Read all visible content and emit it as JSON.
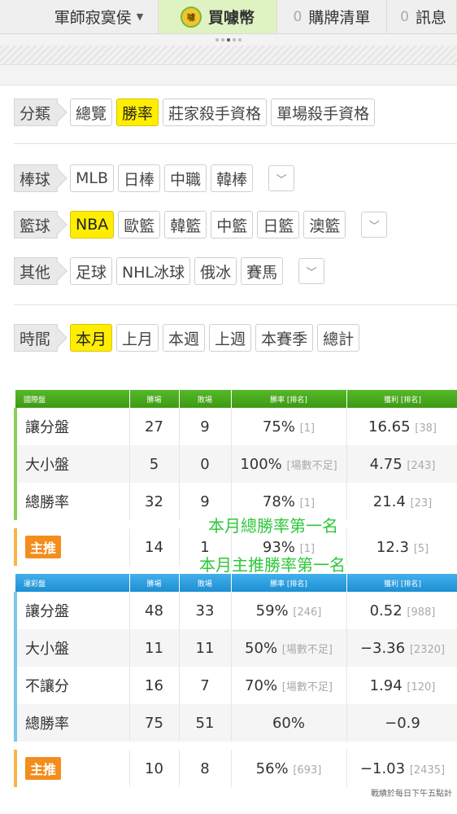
{
  "nav": {
    "user_name": "軍師寂寞侯",
    "buy_label": "買噱幣",
    "buy_coin_text": "噱",
    "cart_count": "0",
    "cart_label": "購牌清單",
    "msg_count": "0",
    "msg_label": "訊息"
  },
  "filters": {
    "category": {
      "label": "分類",
      "options": [
        "總覽",
        "勝率",
        "莊家殺手資格",
        "單場殺手資格"
      ],
      "selected": "勝率"
    },
    "baseball": {
      "label": "棒球",
      "options": [
        "MLB",
        "日棒",
        "中職",
        "韓棒"
      ]
    },
    "basketball": {
      "label": "籃球",
      "options": [
        "NBA",
        "歐籃",
        "韓籃",
        "中籃",
        "日籃",
        "澳籃"
      ],
      "selected": "NBA"
    },
    "other": {
      "label": "其他",
      "options": [
        "足球",
        "NHL冰球",
        "俄冰",
        "賽馬"
      ]
    },
    "time": {
      "label": "時間",
      "options": [
        "本月",
        "上月",
        "本週",
        "上週",
        "本賽季",
        "總計"
      ],
      "selected": "本月"
    }
  },
  "intl_table": {
    "headers": [
      "國際盤",
      "勝場",
      "敗場",
      "勝率 [排名]",
      "獲利 [排名]"
    ],
    "rows": [
      {
        "name": "讓分盤",
        "win": "27",
        "lose": "9",
        "rate": "75%",
        "rate_rank": "[1]",
        "profit": "16.65",
        "profit_rank": "[38]"
      },
      {
        "name": "大小盤",
        "win": "5",
        "lose": "0",
        "rate": "100%",
        "rate_rank": "[場數不足]",
        "profit": "4.75",
        "profit_rank": "[243]"
      },
      {
        "name": "總勝率",
        "win": "32",
        "lose": "9",
        "rate": "78%",
        "rate_rank": "[1]",
        "profit": "21.4",
        "profit_rank": "[23]"
      }
    ],
    "recommend": {
      "name": "主推",
      "win": "14",
      "lose": "1",
      "rate": "93%",
      "rate_rank": "[1]",
      "profit": "12.3",
      "profit_rank": "[5]"
    }
  },
  "annotations": {
    "a1": "本月總勝率第一名",
    "a2": "本月主推勝率第一名"
  },
  "lottery_table": {
    "headers": [
      "運彩盤",
      "勝場",
      "敗場",
      "勝率 [排名]",
      "獲利 [排名]"
    ],
    "rows": [
      {
        "name": "讓分盤",
        "win": "48",
        "lose": "33",
        "rate": "59%",
        "rate_rank": "[246]",
        "profit": "0.52",
        "profit_rank": "[988]"
      },
      {
        "name": "大小盤",
        "win": "11",
        "lose": "11",
        "rate": "50%",
        "rate_rank": "[場數不足]",
        "profit": "−3.36",
        "profit_rank": "[2320]"
      },
      {
        "name": "不讓分",
        "win": "16",
        "lose": "7",
        "rate": "70%",
        "rate_rank": "[場數不足]",
        "profit": "1.94",
        "profit_rank": "[120]"
      },
      {
        "name": "總勝率",
        "win": "75",
        "lose": "51",
        "rate": "60%",
        "rate_rank": "",
        "profit": "−0.9",
        "profit_rank": ""
      }
    ],
    "recommend": {
      "name": "主推",
      "win": "10",
      "lose": "8",
      "rate": "56%",
      "rate_rank": "[693]",
      "profit": "−1.03",
      "profit_rank": "[2435]"
    }
  },
  "footer_note": "戰績於每日下午五點計"
}
